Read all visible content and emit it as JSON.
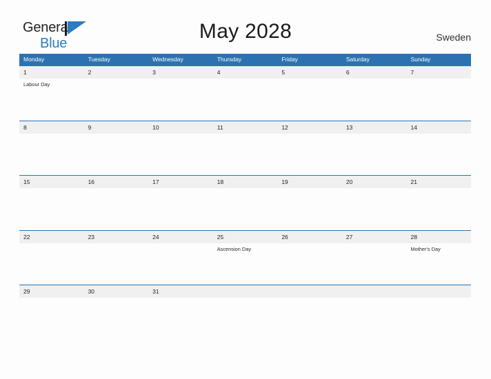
{
  "header": {
    "brand": {
      "line1": "General",
      "line2": "Blue",
      "flag_icon": "blue-triangle-flag-icon"
    },
    "title": "May 2028",
    "country": "Sweden"
  },
  "colors": {
    "header_blue": "#2c72b0",
    "brand_blue": "#2b7cc0",
    "date_band_gray": "#f0f0f0",
    "page_background": "#fdfdfd",
    "text_dark": "#232323"
  },
  "calendar": {
    "weekdays": [
      "Monday",
      "Tuesday",
      "Wednesday",
      "Thursday",
      "Friday",
      "Saturday",
      "Sunday"
    ],
    "weeks": [
      {
        "dates": [
          "1",
          "2",
          "3",
          "4",
          "5",
          "6",
          "7"
        ],
        "events": [
          "Labour Day",
          "",
          "",
          "",
          "",
          "",
          ""
        ]
      },
      {
        "dates": [
          "8",
          "9",
          "10",
          "11",
          "12",
          "13",
          "14"
        ],
        "events": [
          "",
          "",
          "",
          "",
          "",
          "",
          ""
        ]
      },
      {
        "dates": [
          "15",
          "16",
          "17",
          "18",
          "19",
          "20",
          "21"
        ],
        "events": [
          "",
          "",
          "",
          "",
          "",
          "",
          ""
        ]
      },
      {
        "dates": [
          "22",
          "23",
          "24",
          "25",
          "26",
          "27",
          "28"
        ],
        "events": [
          "",
          "",
          "",
          "Ascension Day",
          "",
          "",
          "Mother's Day"
        ]
      },
      {
        "dates": [
          "29",
          "30",
          "31",
          "",
          "",
          "",
          ""
        ],
        "events": [
          "",
          "",
          "",
          "",
          "",
          "",
          ""
        ]
      }
    ]
  }
}
